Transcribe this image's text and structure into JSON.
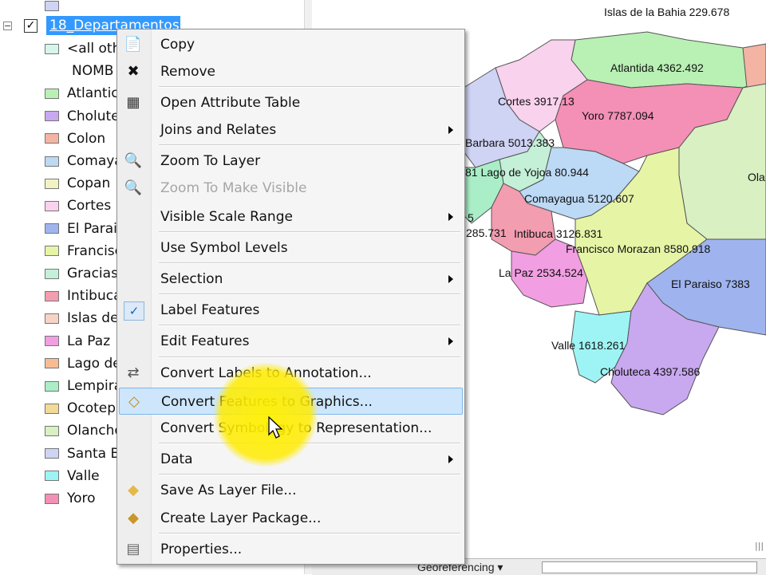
{
  "toc": {
    "layer_name": "18_Departamentos",
    "layer_checked": true,
    "legend": [
      {
        "label": "<all oth",
        "color": "#d6f5ec"
      },
      {
        "label": "NOMB",
        "color": ""
      },
      {
        "label": "Atlantic",
        "color": "#b9f0b4"
      },
      {
        "label": "Cholute",
        "color": "#c8a8ef"
      },
      {
        "label": "Colon",
        "color": "#f3b4a4"
      },
      {
        "label": "Comaya",
        "color": "#bcd9f5"
      },
      {
        "label": "Copan",
        "color": "#f1f3c4"
      },
      {
        "label": "Cortes",
        "color": "#f9d2ee"
      },
      {
        "label": "El Parais",
        "color": "#9fb4ef"
      },
      {
        "label": "Francisc",
        "color": "#e6f4a6"
      },
      {
        "label": "Gracias",
        "color": "#c4f0d8"
      },
      {
        "label": "Intibuca",
        "color": "#f39db1"
      },
      {
        "label": "Islas de",
        "color": "#f7d3c6"
      },
      {
        "label": "La Paz",
        "color": "#f29ee2"
      },
      {
        "label": "Lago de",
        "color": "#f7bc92"
      },
      {
        "label": "Lempira",
        "color": "#a9eec7"
      },
      {
        "label": "Ocotep",
        "color": "#f2da97"
      },
      {
        "label": "Olancho",
        "color": "#d8f0c2"
      },
      {
        "label": "Santa B",
        "color": "#cfd3f4"
      },
      {
        "label": "Valle",
        "color": "#9ef4f4"
      },
      {
        "label": "Yoro",
        "color": "#f48fb5"
      }
    ]
  },
  "context_menu": {
    "items": [
      {
        "label": "Copy",
        "icon": "copy-icon",
        "enabled": true,
        "submenu": false
      },
      {
        "label": "Remove",
        "icon": "remove-x-icon",
        "enabled": true,
        "submenu": false
      },
      {
        "label": "Open Attribute Table",
        "icon": "table-icon",
        "enabled": true,
        "submenu": false
      },
      {
        "label": "Joins and Relates",
        "icon": "",
        "enabled": true,
        "submenu": true
      },
      {
        "label": "Zoom To Layer",
        "icon": "zoom-layer-icon",
        "enabled": true,
        "submenu": false
      },
      {
        "label": "Zoom To Make Visible",
        "icon": "zoom-visible-icon",
        "enabled": false,
        "submenu": false
      },
      {
        "label": "Visible Scale Range",
        "icon": "",
        "enabled": true,
        "submenu": true
      },
      {
        "label": "Use Symbol Levels",
        "icon": "",
        "enabled": true,
        "submenu": false
      },
      {
        "label": "Selection",
        "icon": "",
        "enabled": true,
        "submenu": true
      },
      {
        "label": "Label Features",
        "icon": "checkmark-icon",
        "enabled": true,
        "submenu": false,
        "checked": true
      },
      {
        "label": "Edit Features",
        "icon": "",
        "enabled": true,
        "submenu": true
      },
      {
        "label": "Convert Labels to Annotation...",
        "icon": "convert-labels-icon",
        "enabled": true,
        "submenu": false
      },
      {
        "label": "Convert Features to Graphics...",
        "icon": "convert-graphics-icon",
        "enabled": true,
        "submenu": false,
        "highlighted": true
      },
      {
        "label": "Convert Symbology to Representation...",
        "icon": "",
        "enabled": true,
        "submenu": false
      },
      {
        "label": "Data",
        "icon": "",
        "enabled": true,
        "submenu": true
      },
      {
        "label": "Save As Layer File...",
        "icon": "layer-file-icon",
        "enabled": true,
        "submenu": false
      },
      {
        "label": "Create Layer Package...",
        "icon": "layer-package-icon",
        "enabled": true,
        "submenu": false
      },
      {
        "label": "Properties...",
        "icon": "properties-icon",
        "enabled": true,
        "submenu": false
      }
    ]
  },
  "map": {
    "labels": [
      "Islas de la Bahia 229.678",
      "Atlantida 4362.492",
      "Cortes 3917.13",
      "Yoro 7787.094",
      "Barbara 5013.383",
      "Ola",
      "81 Lago de Yojoa 80.944",
      "Comayagua 5120.607",
      "5",
      "285.731",
      "Intibuca 3126.831",
      "Francisco Morazan 8580.918",
      "La Paz 2534.524",
      "El Paraiso 7383",
      "Valle 1618.261",
      "Choluteca 4397.586"
    ]
  },
  "status_bar": {
    "georeferencing_label": "Georeferencing ▾"
  }
}
